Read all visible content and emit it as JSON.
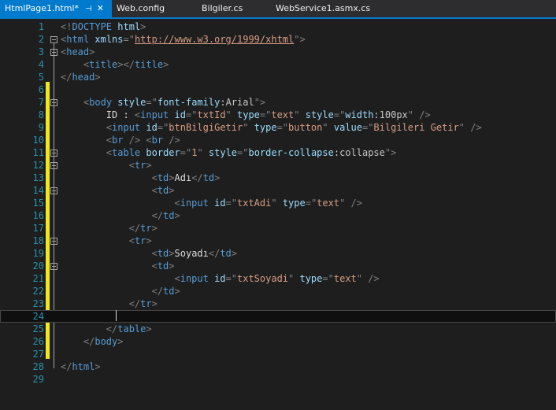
{
  "tabs": [
    {
      "label": "HtmlPage1.html*",
      "active": true
    },
    {
      "label": "Web.config",
      "active": false
    },
    {
      "label": "Bilgiler.cs",
      "active": false
    },
    {
      "label": "WebService1.asmx.cs",
      "active": false
    }
  ],
  "tab_icons": {
    "pin": "pin-icon",
    "close": "close-icon"
  },
  "editor": {
    "line_numbers": [
      "1",
      "2",
      "3",
      "4",
      "5",
      "6",
      "7",
      "8",
      "9",
      "10",
      "11",
      "12",
      "13",
      "14",
      "15",
      "16",
      "17",
      "18",
      "19",
      "20",
      "21",
      "22",
      "23",
      "24",
      "25",
      "26",
      "27",
      "28",
      "29"
    ],
    "current_line": 24,
    "lines": [
      [
        {
          "k": "d",
          "t": "<!"
        },
        {
          "k": "t",
          "t": "DOCTYPE"
        },
        {
          "k": "v",
          "t": " "
        },
        {
          "k": "a",
          "t": "html"
        },
        {
          "k": "d",
          "t": ">"
        }
      ],
      [
        {
          "k": "d",
          "t": "<"
        },
        {
          "k": "t",
          "t": "html"
        },
        {
          "k": "v",
          "t": " "
        },
        {
          "k": "a",
          "t": "xmlns"
        },
        {
          "k": "d",
          "t": "=\""
        },
        {
          "k": "u",
          "t": "http://www.w3.org/1999/xhtml"
        },
        {
          "k": "d",
          "t": "\">"
        }
      ],
      [
        {
          "k": "d",
          "t": "<"
        },
        {
          "k": "t",
          "t": "head"
        },
        {
          "k": "d",
          "t": ">"
        }
      ],
      [
        {
          "k": "v",
          "t": "    "
        },
        {
          "k": "d",
          "t": "<"
        },
        {
          "k": "t",
          "t": "title"
        },
        {
          "k": "d",
          "t": "></"
        },
        {
          "k": "t",
          "t": "title"
        },
        {
          "k": "d",
          "t": ">"
        }
      ],
      [
        {
          "k": "d",
          "t": "</"
        },
        {
          "k": "t",
          "t": "head"
        },
        {
          "k": "d",
          "t": ">"
        }
      ],
      [],
      [
        {
          "k": "v",
          "t": "    "
        },
        {
          "k": "d",
          "t": "<"
        },
        {
          "k": "t",
          "t": "body"
        },
        {
          "k": "v",
          "t": " "
        },
        {
          "k": "a",
          "t": "style"
        },
        {
          "k": "d",
          "t": "=\""
        },
        {
          "k": "a",
          "t": "font-family"
        },
        {
          "k": "v",
          "t": ":Arial"
        },
        {
          "k": "d",
          "t": "\">"
        }
      ],
      [
        {
          "k": "x",
          "t": "        ID : "
        },
        {
          "k": "d",
          "t": "<"
        },
        {
          "k": "t",
          "t": "input"
        },
        {
          "k": "v",
          "t": " "
        },
        {
          "k": "a",
          "t": "id"
        },
        {
          "k": "d",
          "t": "=\""
        },
        {
          "k": "s",
          "t": "txtId"
        },
        {
          "k": "d",
          "t": "\" "
        },
        {
          "k": "a",
          "t": "type"
        },
        {
          "k": "d",
          "t": "=\""
        },
        {
          "k": "s",
          "t": "text"
        },
        {
          "k": "d",
          "t": "\" "
        },
        {
          "k": "a",
          "t": "style"
        },
        {
          "k": "d",
          "t": "=\""
        },
        {
          "k": "a",
          "t": "width"
        },
        {
          "k": "v",
          "t": ":100px"
        },
        {
          "k": "d",
          "t": "\" />"
        }
      ],
      [
        {
          "k": "v",
          "t": "        "
        },
        {
          "k": "d",
          "t": "<"
        },
        {
          "k": "t",
          "t": "input"
        },
        {
          "k": "v",
          "t": " "
        },
        {
          "k": "a",
          "t": "id"
        },
        {
          "k": "d",
          "t": "=\""
        },
        {
          "k": "s",
          "t": "btnBilgiGetir"
        },
        {
          "k": "d",
          "t": "\" "
        },
        {
          "k": "a",
          "t": "type"
        },
        {
          "k": "d",
          "t": "=\""
        },
        {
          "k": "s",
          "t": "button"
        },
        {
          "k": "d",
          "t": "\" "
        },
        {
          "k": "a",
          "t": "value"
        },
        {
          "k": "d",
          "t": "=\""
        },
        {
          "k": "s",
          "t": "Bilgileri Getir"
        },
        {
          "k": "d",
          "t": "\" />"
        }
      ],
      [
        {
          "k": "v",
          "t": "        "
        },
        {
          "k": "d",
          "t": "<"
        },
        {
          "k": "t",
          "t": "br"
        },
        {
          "k": "v",
          "t": " "
        },
        {
          "k": "d",
          "t": "/> <"
        },
        {
          "k": "t",
          "t": "br"
        },
        {
          "k": "v",
          "t": " "
        },
        {
          "k": "d",
          "t": "/>"
        }
      ],
      [
        {
          "k": "v",
          "t": "        "
        },
        {
          "k": "d",
          "t": "<"
        },
        {
          "k": "t",
          "t": "table"
        },
        {
          "k": "v",
          "t": " "
        },
        {
          "k": "a",
          "t": "border"
        },
        {
          "k": "d",
          "t": "=\""
        },
        {
          "k": "s",
          "t": "1"
        },
        {
          "k": "d",
          "t": "\" "
        },
        {
          "k": "a",
          "t": "style"
        },
        {
          "k": "d",
          "t": "=\""
        },
        {
          "k": "a",
          "t": "border-collapse"
        },
        {
          "k": "v",
          "t": ":collapse"
        },
        {
          "k": "d",
          "t": "\">"
        }
      ],
      [
        {
          "k": "v",
          "t": "            "
        },
        {
          "k": "d",
          "t": "<"
        },
        {
          "k": "t",
          "t": "tr"
        },
        {
          "k": "d",
          "t": ">"
        }
      ],
      [
        {
          "k": "v",
          "t": "                "
        },
        {
          "k": "d",
          "t": "<"
        },
        {
          "k": "t",
          "t": "td"
        },
        {
          "k": "d",
          "t": ">"
        },
        {
          "k": "x",
          "t": "Adı"
        },
        {
          "k": "d",
          "t": "</"
        },
        {
          "k": "t",
          "t": "td"
        },
        {
          "k": "d",
          "t": ">"
        }
      ],
      [
        {
          "k": "v",
          "t": "                "
        },
        {
          "k": "d",
          "t": "<"
        },
        {
          "k": "t",
          "t": "td"
        },
        {
          "k": "d",
          "t": ">"
        }
      ],
      [
        {
          "k": "v",
          "t": "                    "
        },
        {
          "k": "d",
          "t": "<"
        },
        {
          "k": "t",
          "t": "input"
        },
        {
          "k": "v",
          "t": " "
        },
        {
          "k": "a",
          "t": "id"
        },
        {
          "k": "d",
          "t": "=\""
        },
        {
          "k": "s",
          "t": "txtAdi"
        },
        {
          "k": "d",
          "t": "\" "
        },
        {
          "k": "a",
          "t": "type"
        },
        {
          "k": "d",
          "t": "=\""
        },
        {
          "k": "s",
          "t": "text"
        },
        {
          "k": "d",
          "t": "\" />"
        }
      ],
      [
        {
          "k": "v",
          "t": "                "
        },
        {
          "k": "d",
          "t": "</"
        },
        {
          "k": "t",
          "t": "td"
        },
        {
          "k": "d",
          "t": ">"
        }
      ],
      [
        {
          "k": "v",
          "t": "            "
        },
        {
          "k": "d",
          "t": "</"
        },
        {
          "k": "t",
          "t": "tr"
        },
        {
          "k": "d",
          "t": ">"
        }
      ],
      [
        {
          "k": "v",
          "t": "            "
        },
        {
          "k": "d",
          "t": "<"
        },
        {
          "k": "t",
          "t": "tr"
        },
        {
          "k": "d",
          "t": ">"
        }
      ],
      [
        {
          "k": "v",
          "t": "                "
        },
        {
          "k": "d",
          "t": "<"
        },
        {
          "k": "t",
          "t": "td"
        },
        {
          "k": "d",
          "t": ">"
        },
        {
          "k": "x",
          "t": "Soyadı"
        },
        {
          "k": "d",
          "t": "</"
        },
        {
          "k": "t",
          "t": "td"
        },
        {
          "k": "d",
          "t": ">"
        }
      ],
      [
        {
          "k": "v",
          "t": "                "
        },
        {
          "k": "d",
          "t": "<"
        },
        {
          "k": "t",
          "t": "td"
        },
        {
          "k": "d",
          "t": ">"
        }
      ],
      [
        {
          "k": "v",
          "t": "                    "
        },
        {
          "k": "d",
          "t": "<"
        },
        {
          "k": "t",
          "t": "input"
        },
        {
          "k": "v",
          "t": " "
        },
        {
          "k": "a",
          "t": "id"
        },
        {
          "k": "d",
          "t": "=\""
        },
        {
          "k": "s",
          "t": "txtSoyadi"
        },
        {
          "k": "d",
          "t": "\" "
        },
        {
          "k": "a",
          "t": "type"
        },
        {
          "k": "d",
          "t": "=\""
        },
        {
          "k": "s",
          "t": "text"
        },
        {
          "k": "d",
          "t": "\" />"
        }
      ],
      [
        {
          "k": "v",
          "t": "                "
        },
        {
          "k": "d",
          "t": "</"
        },
        {
          "k": "t",
          "t": "td"
        },
        {
          "k": "d",
          "t": ">"
        }
      ],
      [
        {
          "k": "v",
          "t": "            "
        },
        {
          "k": "d",
          "t": "</"
        },
        {
          "k": "t",
          "t": "tr"
        },
        {
          "k": "d",
          "t": ">"
        }
      ],
      [],
      [
        {
          "k": "v",
          "t": "        "
        },
        {
          "k": "d",
          "t": "</"
        },
        {
          "k": "t",
          "t": "table"
        },
        {
          "k": "d",
          "t": ">"
        }
      ],
      [
        {
          "k": "v",
          "t": "    "
        },
        {
          "k": "d",
          "t": "</"
        },
        {
          "k": "t",
          "t": "body"
        },
        {
          "k": "d",
          "t": ">"
        }
      ],
      [],
      [
        {
          "k": "d",
          "t": "</"
        },
        {
          "k": "t",
          "t": "html"
        },
        {
          "k": "d",
          "t": ">"
        }
      ],
      []
    ],
    "fold_lines": [
      2,
      3,
      7,
      11,
      12,
      14,
      18,
      20
    ]
  },
  "colors": {
    "background": "#1e1e1e",
    "tab_active": "#007acc",
    "line_number": "#2b91af",
    "tag": "#569cd6",
    "attribute": "#9cdcfe",
    "string": "#d69d85",
    "delimiter": "#808080",
    "change_marker": "#efe81d"
  }
}
